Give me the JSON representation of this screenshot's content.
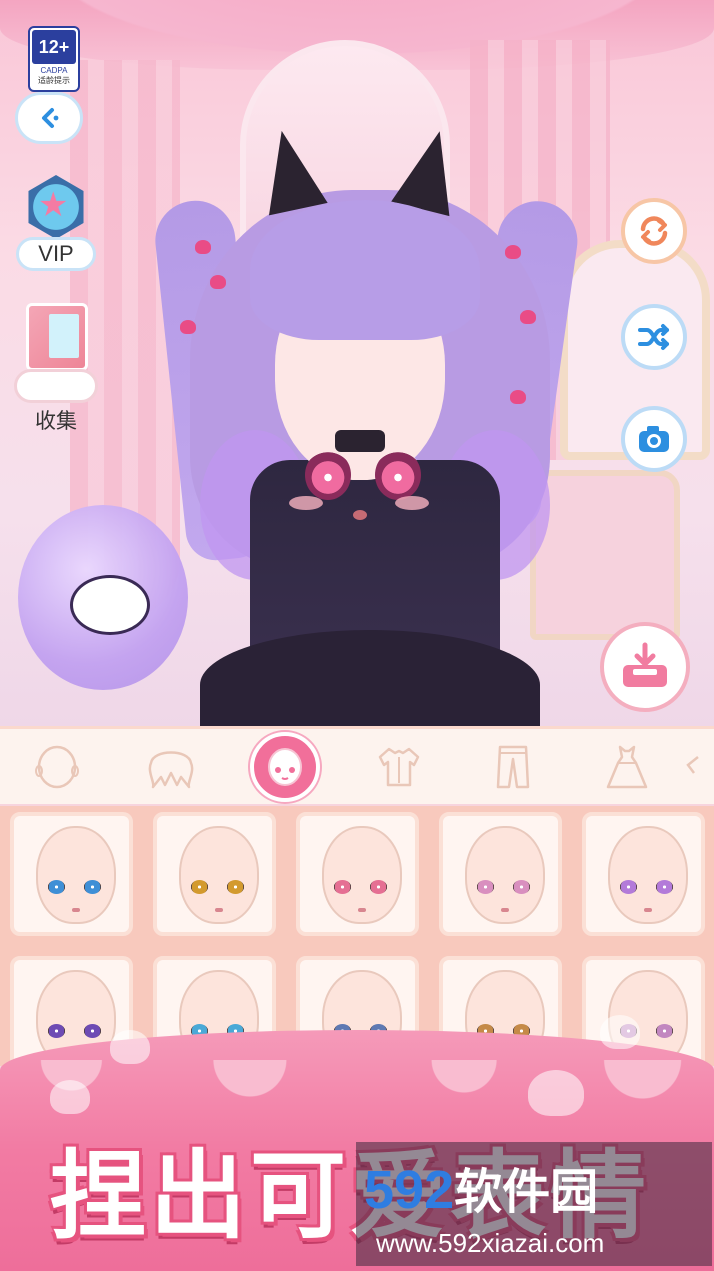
{
  "age_rating": {
    "number": "12+",
    "org": "CADPA",
    "note": "适龄提示"
  },
  "sidebar": {
    "vip_label": "VIP",
    "collect_label": "收集"
  },
  "icons": {
    "back": "chevron-left-icon",
    "refresh": "refresh-icon",
    "shuffle": "shuffle-icon",
    "camera": "camera-icon",
    "download": "download-tray-icon"
  },
  "categories": [
    {
      "name": "face-shape",
      "icon": "head-outline-icon"
    },
    {
      "name": "hair",
      "icon": "hair-icon"
    },
    {
      "name": "expression",
      "icon": "face-expression-icon",
      "active": true
    },
    {
      "name": "top",
      "icon": "shirt-icon"
    },
    {
      "name": "pants",
      "icon": "pants-icon"
    },
    {
      "name": "dress",
      "icon": "dress-icon"
    }
  ],
  "face_options": [
    {
      "eye_color": "#3f8fd6"
    },
    {
      "eye_color": "#d39a2e"
    },
    {
      "eye_color": "#e56f93"
    },
    {
      "eye_color": "#d98fbf"
    },
    {
      "eye_color": "#b37ad9"
    },
    {
      "eye_color": "#6e4bb4"
    },
    {
      "eye_color": "#4aa9d7"
    },
    {
      "eye_color": "#5e79b3"
    },
    {
      "eye_color": "#c58a48"
    },
    {
      "eye_color": "#c287c0"
    }
  ],
  "banner": {
    "slogan": "捏出可爱表情"
  },
  "watermark": {
    "number": "592",
    "text": "软件园",
    "url": "www.592xiazai.com"
  },
  "colors": {
    "accent": "#f16f9a",
    "tile_border": "#fbe0d6",
    "grid_bg": "#f8c9bd"
  }
}
